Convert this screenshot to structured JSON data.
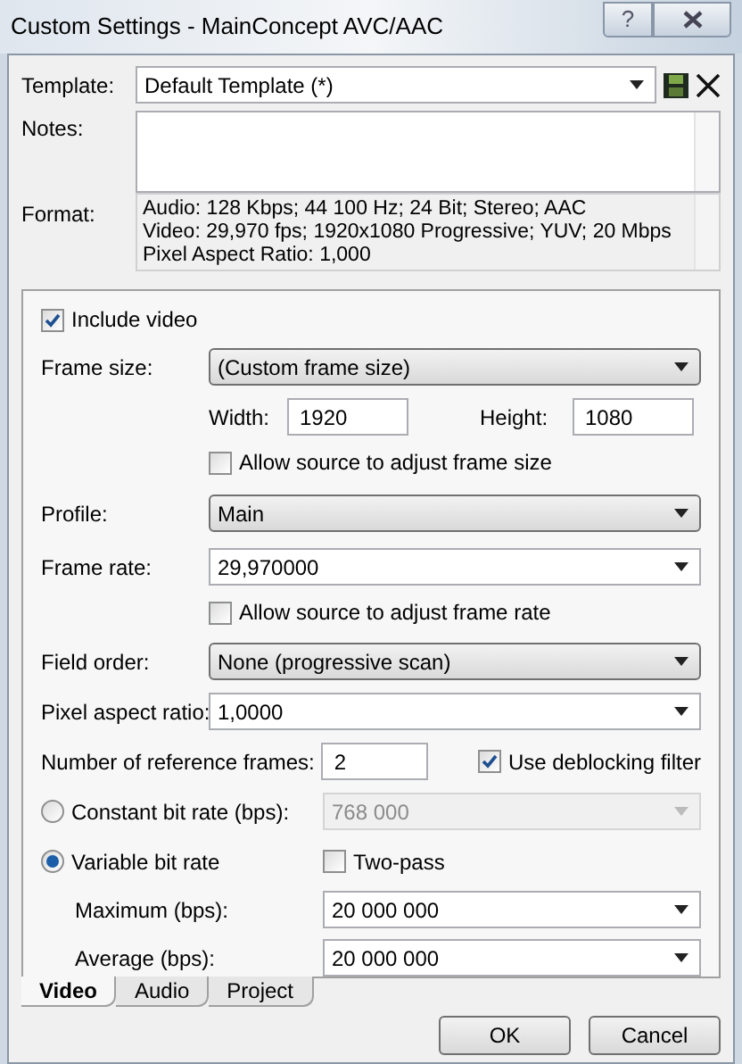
{
  "window": {
    "title": "Custom Settings - MainConcept AVC/AAC",
    "help": "?"
  },
  "template": {
    "label": "Template:",
    "value": "Default Template (*)"
  },
  "notes": {
    "label": "Notes:"
  },
  "format": {
    "label": "Format:",
    "lines": [
      "Audio: 128 Kbps; 44 100 Hz; 24 Bit; Stereo; AAC",
      "Video: 29,970 fps; 1920x1080 Progressive; YUV; 20 Mbps",
      "Pixel Aspect Ratio: 1,000"
    ]
  },
  "include_video": {
    "label": "Include video",
    "checked": true
  },
  "frame_size": {
    "label": "Frame size:",
    "value": "(Custom frame size)",
    "kind": "dropdown"
  },
  "width": {
    "label": "Width:",
    "value": "1920"
  },
  "height": {
    "label": "Height:",
    "value": "1080"
  },
  "allow_size": {
    "label": "Allow source to adjust frame size",
    "checked": false
  },
  "profile": {
    "label": "Profile:",
    "value": "Main",
    "kind": "dropdown"
  },
  "frame_rate": {
    "label": "Frame rate:",
    "value": "29,970000",
    "kind": "combo"
  },
  "allow_rate": {
    "label": "Allow source to adjust frame rate",
    "checked": false
  },
  "field_order": {
    "label": "Field order:",
    "value": "None (progressive scan)",
    "kind": "dropdown"
  },
  "pixel_aspect": {
    "label": "Pixel aspect ratio:",
    "value": "1,0000",
    "kind": "combo"
  },
  "ref_frames": {
    "label": "Number of reference frames:",
    "value": "2"
  },
  "deblocking": {
    "label": "Use deblocking filter",
    "checked": true
  },
  "cbr": {
    "label": "Constant bit rate (bps):",
    "selected": false,
    "value": "768 000",
    "disabled": true
  },
  "vbr": {
    "label": "Variable bit rate",
    "selected": true
  },
  "two_pass": {
    "label": "Two-pass",
    "checked": false
  },
  "maximum": {
    "label": "Maximum (bps):",
    "value": "20 000 000",
    "kind": "combo"
  },
  "average": {
    "label": "Average (bps):",
    "value": "20 000 000",
    "kind": "combo"
  },
  "tabs": [
    {
      "label": "Video",
      "selected": true
    },
    {
      "label": "Audio",
      "selected": false
    },
    {
      "label": "Project",
      "selected": false
    }
  ],
  "buttons": [
    "OK",
    "Cancel"
  ]
}
